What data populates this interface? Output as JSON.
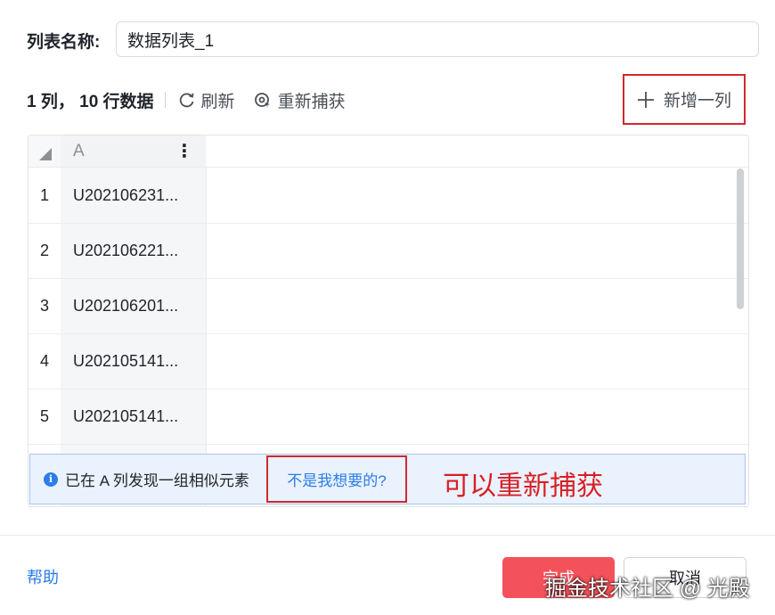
{
  "form": {
    "name_label": "列表名称:",
    "name_value": "数据列表_1"
  },
  "toolbar": {
    "stats": "1 列， 10 行数据",
    "refresh_label": "刷新",
    "recapture_label": "重新捕获",
    "add_column_label": "新增一列"
  },
  "table": {
    "column_header": "A",
    "rows": [
      {
        "num": "1",
        "value": "U202106231..."
      },
      {
        "num": "2",
        "value": "U202106221..."
      },
      {
        "num": "3",
        "value": "U202106201..."
      },
      {
        "num": "4",
        "value": "U202105141..."
      },
      {
        "num": "5",
        "value": "U202105141..."
      }
    ]
  },
  "notice": {
    "icon": "info-icon",
    "text": "已在 A 列发现一组相似元素",
    "link": "不是我想要的?"
  },
  "annotation": "可以重新捕获",
  "footer": {
    "help": "帮助",
    "done": "完成",
    "cancel": "取消"
  },
  "watermark": "掘金技术社区 @ 光殿",
  "colors": {
    "accent": "#2b7de9",
    "primary_button": "#f4525a",
    "annotation": "#d81f26"
  }
}
